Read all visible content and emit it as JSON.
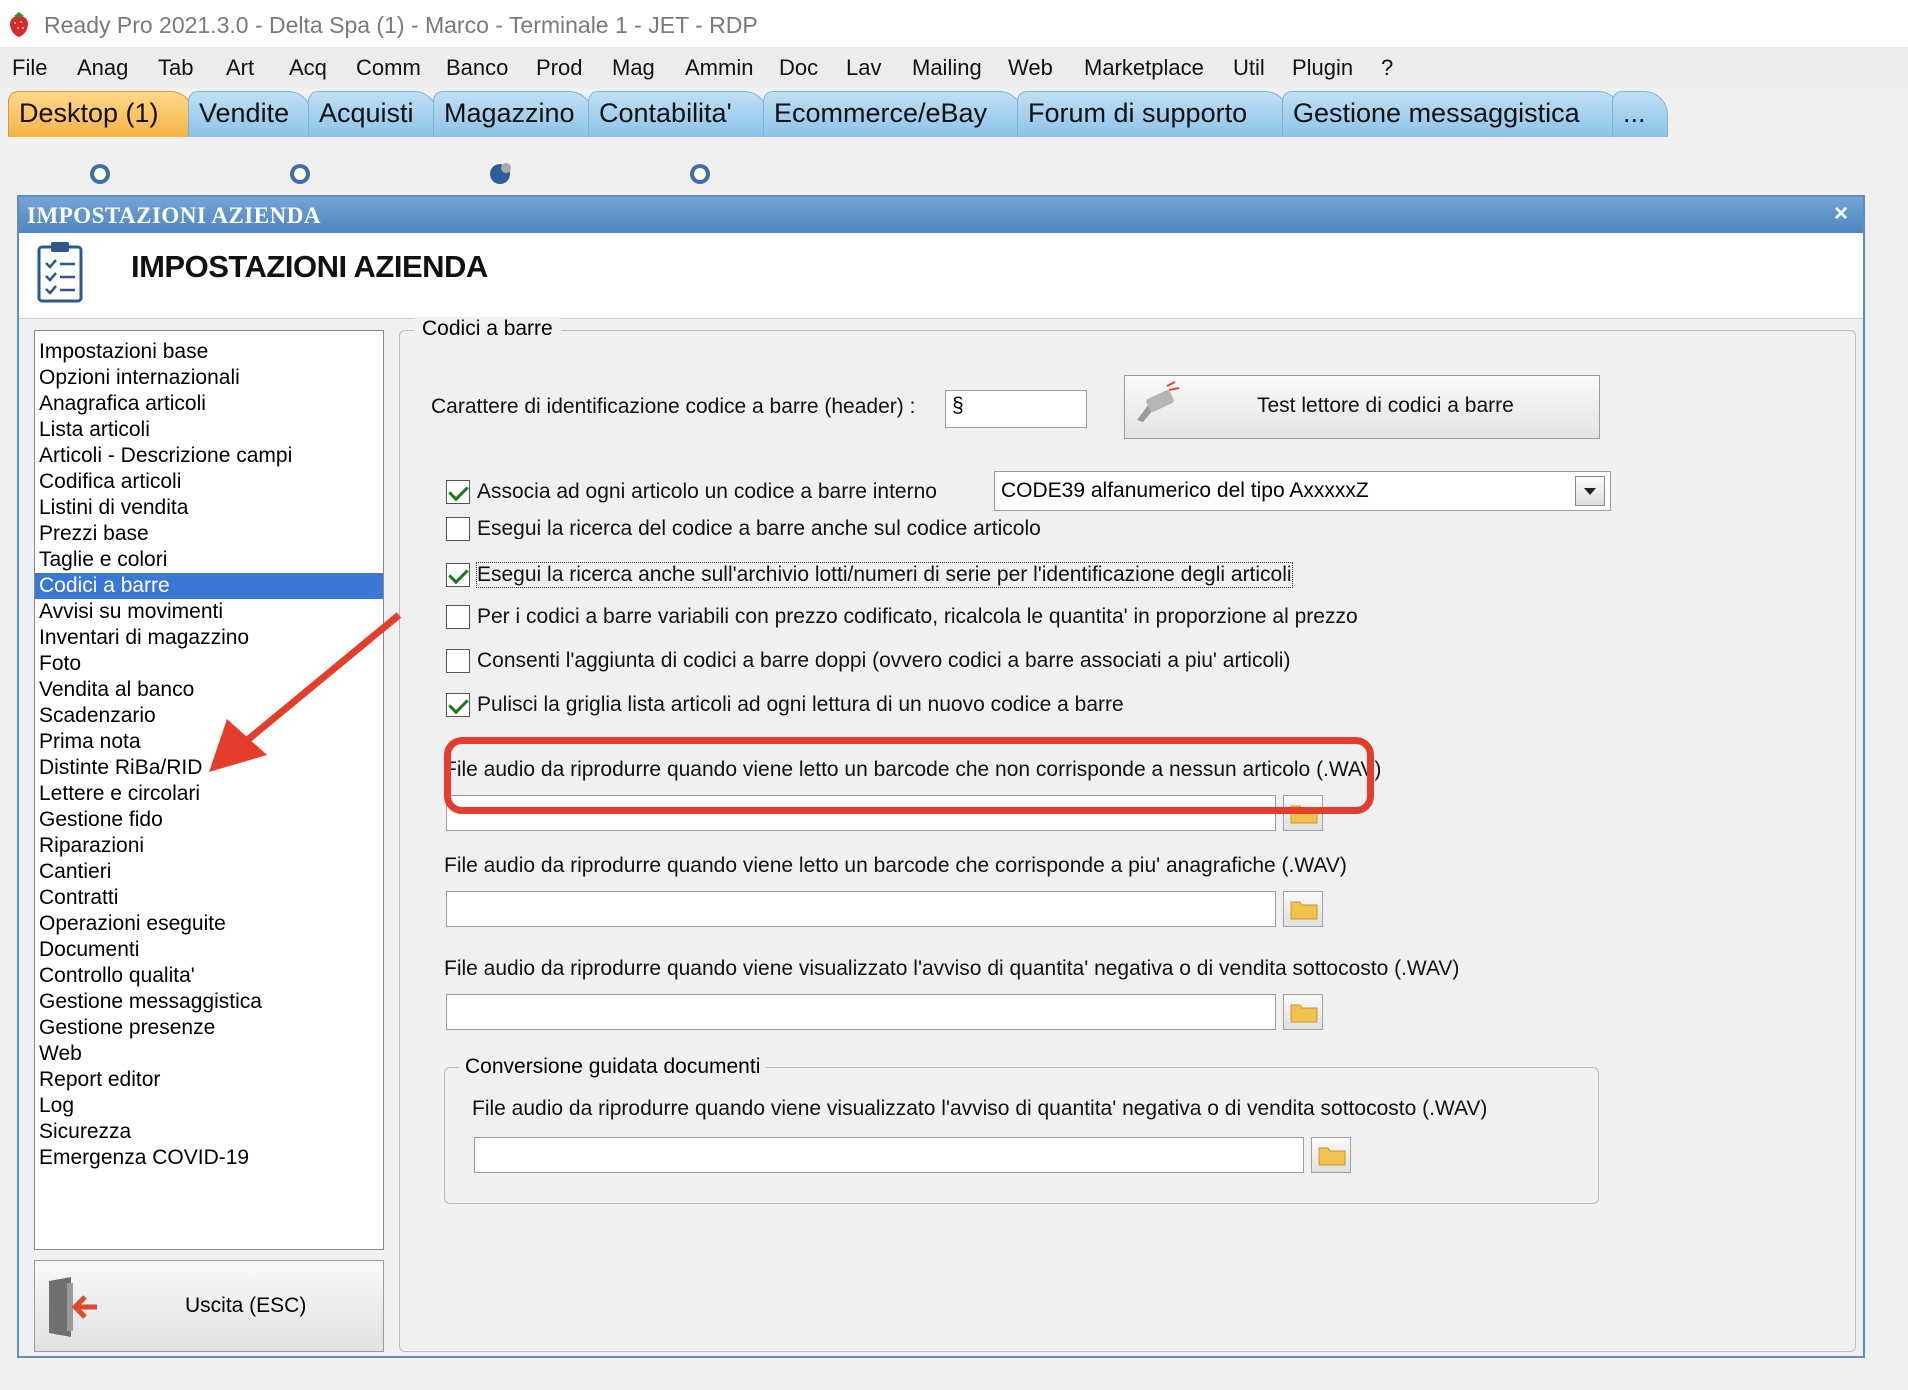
{
  "window": {
    "title": "Ready Pro 2021.3.0 - Delta Spa (1) - Marco - Terminale 1 - JET - RDP"
  },
  "menu": [
    "File",
    "Anag",
    "Tab",
    "Art",
    "Acq",
    "Comm",
    "Banco",
    "Prod",
    "Mag",
    "Ammin",
    "Doc",
    "Lav",
    "Mailing",
    "Web",
    "Marketplace",
    "Util",
    "Plugin",
    "?"
  ],
  "tabs": [
    "Desktop (1)",
    "Vendite",
    "Acquisti",
    "Magazzino",
    "Contabilita'",
    "Ecommerce/eBay",
    "Forum di supporto",
    "Gestione messaggistica",
    "..."
  ],
  "dialog": {
    "caption": "IMPOSTAZIONI AZIENDA",
    "close": "×",
    "header_title": "IMPOSTAZIONI AZIENDA",
    "exit_label": "Uscita (ESC)"
  },
  "nav": {
    "selected_index": 9,
    "items": [
      "Impostazioni base",
      "Opzioni internazionali",
      "Anagrafica articoli",
      "Lista articoli",
      "Articoli - Descrizione campi",
      "Codifica articoli",
      "Listini di vendita",
      "Prezzi base",
      "Taglie e colori",
      "Codici a barre",
      "Avvisi su movimenti",
      "Inventari di magazzino",
      "Foto",
      "Vendita al banco",
      "Scadenzario",
      "Prima nota",
      "Distinte RiBa/RID",
      "Lettere e circolari",
      "Gestione fido",
      "Riparazioni",
      "Cantieri",
      "Contratti",
      "Operazioni eseguite",
      "Documenti",
      "Controllo qualita'",
      "Gestione messaggistica",
      "Gestione presenze",
      "Web",
      "Report editor",
      "Log",
      "Sicurezza",
      "Emergenza COVID-19"
    ]
  },
  "barcode": {
    "group_title": "Codici a barre",
    "header_label": "Carattere di identificazione codice a barre (header) :",
    "header_value": "§",
    "test_button": "Test lettore di codici a barre",
    "options": [
      {
        "label": "Associa ad ogni articolo un codice a barre interno",
        "checked": true
      },
      {
        "label": "Esegui la ricerca del codice a barre anche sul codice articolo",
        "checked": false
      },
      {
        "label": "Esegui la ricerca anche sull'archivio lotti/numeri di serie per l'identificazione degli articoli",
        "checked": true
      },
      {
        "label": "Per i codici a barre variabili con prezzo codificato, ricalcola le quantita' in proporzione al prezzo",
        "checked": false
      },
      {
        "label": "Consenti l'aggiunta di codici a barre doppi (ovvero codici a barre associati a piu' articoli)",
        "checked": false
      },
      {
        "label": "Pulisci la griglia lista articoli ad ogni lettura di un nuovo codice a barre",
        "checked": true
      }
    ],
    "combo_value": "CODE39 alfanumerico del tipo AxxxxxZ",
    "audio_1_label": "File audio da riprodurre quando viene letto un barcode che non corrisponde a nessun articolo (.WAV)",
    "audio_1_value": "",
    "audio_2_label": "File audio da riprodurre quando viene letto un barcode che corrisponde a piu' anagrafiche (.WAV)",
    "audio_2_value": "",
    "audio_3_label": "File audio da riprodurre quando viene visualizzato l'avviso di quantita' negativa o di vendita sottocosto (.WAV)",
    "audio_3_value": "",
    "sub_group_title": "Conversione guidata documenti",
    "audio_4_label": "File audio da riprodurre quando viene visualizzato l'avviso di quantita' negativa o di vendita sottocosto (.WAV)",
    "audio_4_value": ""
  },
  "colors": {
    "accent": "#3a78d6",
    "annotation": "#e53d2c",
    "tab_active": "#f6b347",
    "tab_inactive": "#8dc3e8"
  },
  "icons": {
    "app": "strawberry-icon",
    "header": "clipboard-checklist-icon",
    "test": "barcode-scanner-icon",
    "exit": "exit-door-icon",
    "browse": "folder-icon"
  }
}
